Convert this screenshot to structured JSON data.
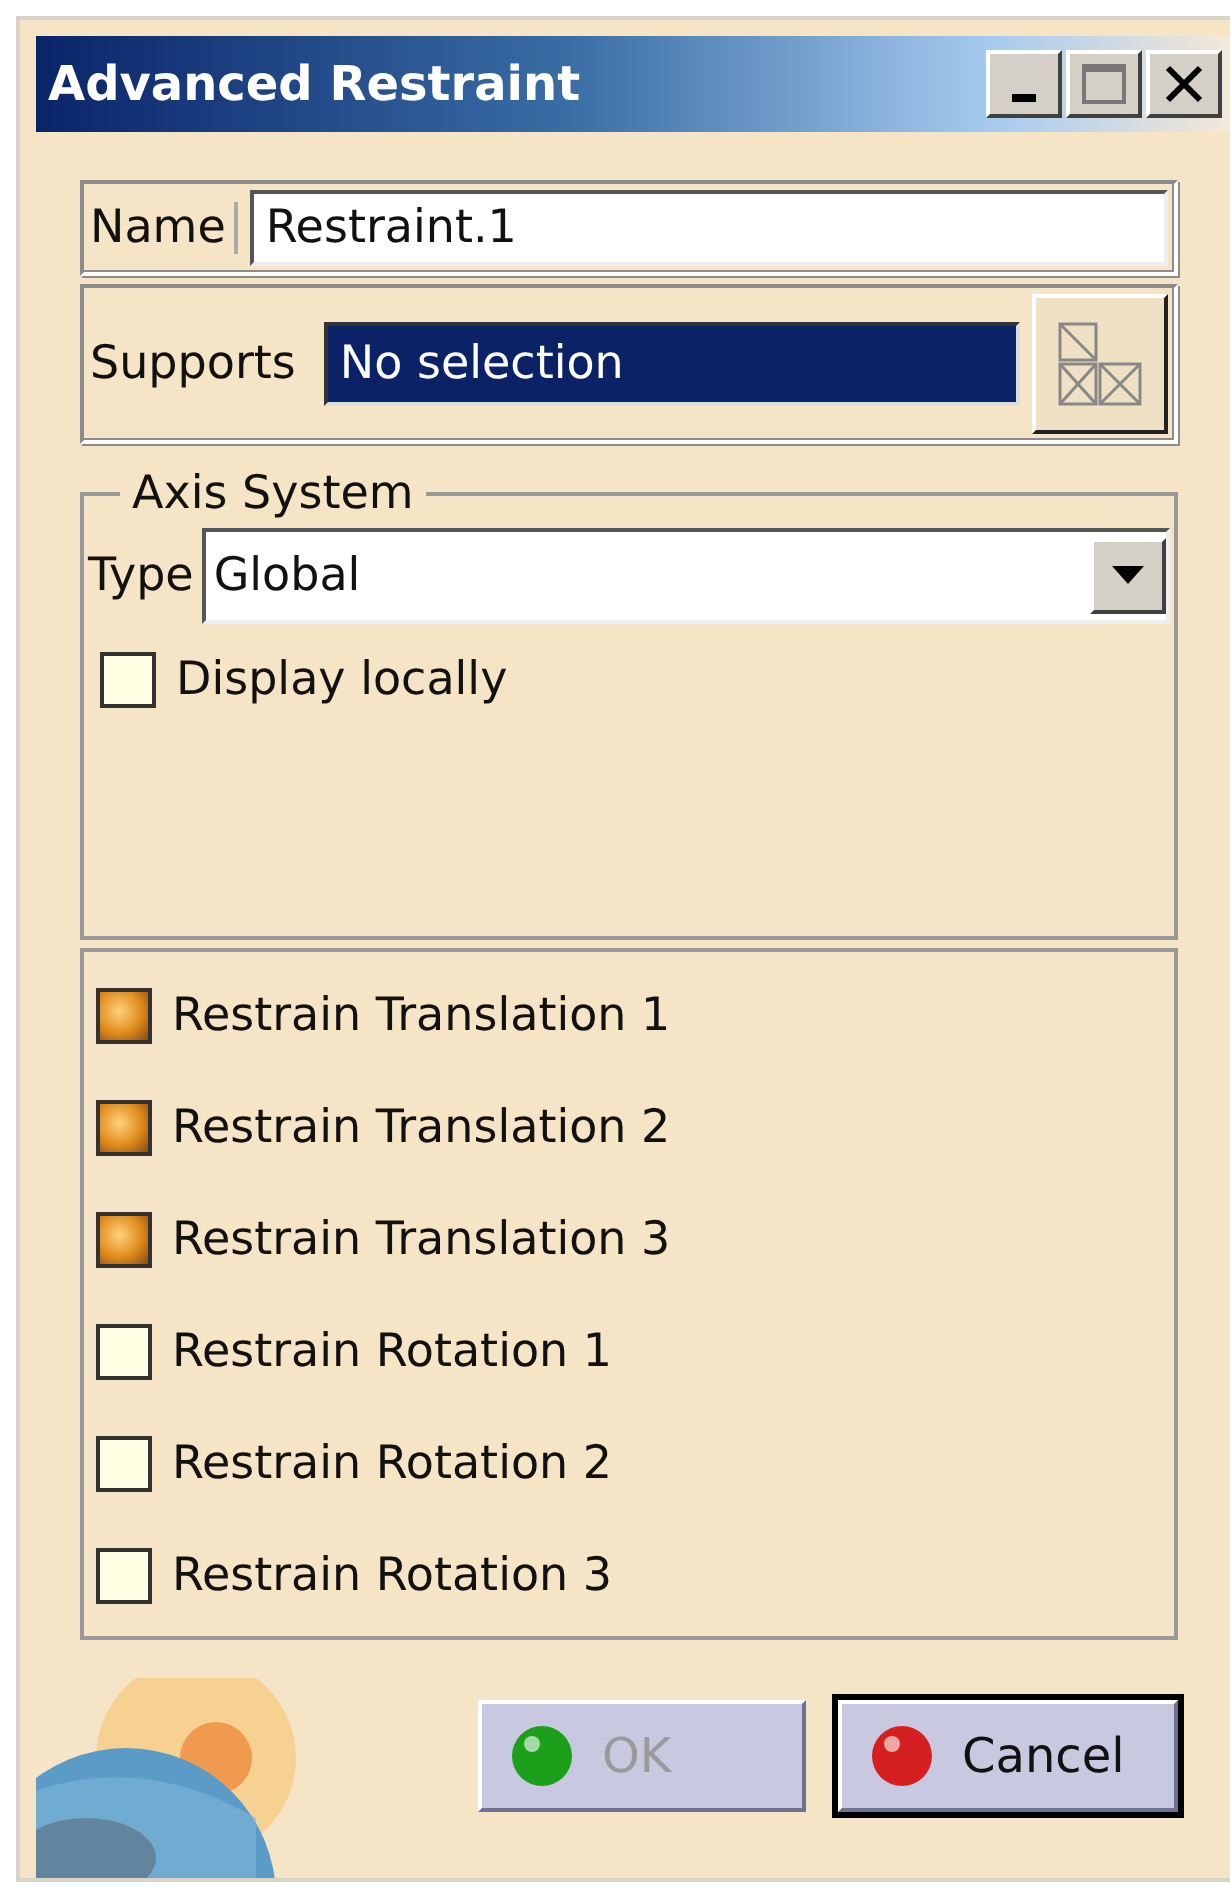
{
  "window": {
    "title": "Advanced Restraint"
  },
  "name": {
    "label": "Name",
    "value": "Restraint.1"
  },
  "supports": {
    "label": "Supports",
    "value": "No selection"
  },
  "axis_system": {
    "title": "Axis System",
    "type_label": "Type",
    "type_value": "Global",
    "display_locally": {
      "label": "Display locally",
      "checked": false
    }
  },
  "restraints": [
    {
      "label": "Restrain Translation 1",
      "checked": true
    },
    {
      "label": "Restrain Translation 2",
      "checked": true
    },
    {
      "label": "Restrain Translation 3",
      "checked": true
    },
    {
      "label": "Restrain Rotation 1",
      "checked": false
    },
    {
      "label": "Restrain Rotation 2",
      "checked": false
    },
    {
      "label": "Restrain Rotation 3",
      "checked": false
    }
  ],
  "buttons": [
    {
      "kind": "ok",
      "label": "OK",
      "disabled": true
    },
    {
      "kind": "cancel",
      "label": "Cancel",
      "disabled": false
    }
  ]
}
